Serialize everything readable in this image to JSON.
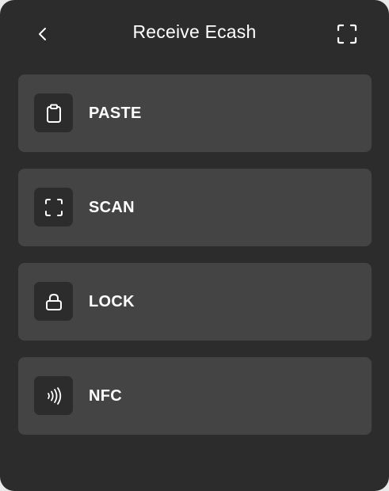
{
  "header": {
    "title": "Receive Ecash",
    "back_icon": "chevron-left-icon",
    "scan_icon": "scan-frame-icon"
  },
  "options": [
    {
      "label": "PASTE",
      "icon": "clipboard-icon"
    },
    {
      "label": "SCAN",
      "icon": "scan-frame-icon"
    },
    {
      "label": "LOCK",
      "icon": "lock-icon"
    },
    {
      "label": "NFC",
      "icon": "nfc-icon"
    }
  ],
  "colors": {
    "sheet_background": "#2c2c2c",
    "option_background": "#444444",
    "icon_tile_background": "#2c2c2c",
    "text": "#ffffff"
  }
}
